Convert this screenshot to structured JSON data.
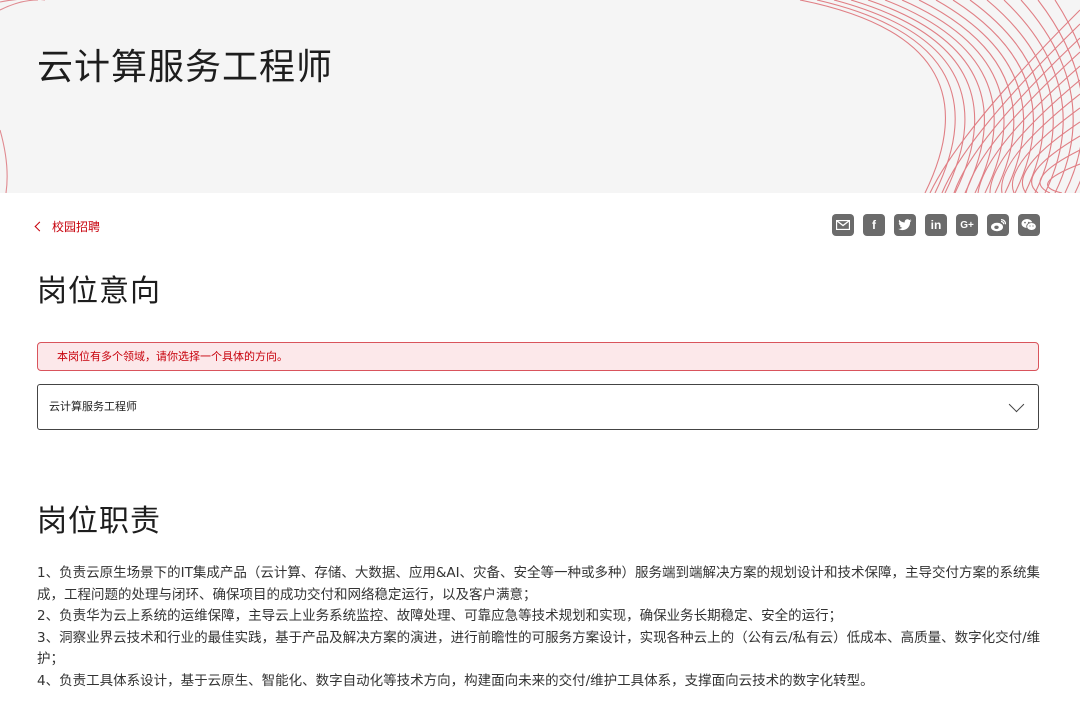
{
  "header": {
    "title": "云计算服务工程师"
  },
  "nav": {
    "back_label": "校园招聘"
  },
  "share_icons": [
    {
      "icon": "email-icon",
      "glyph": ""
    },
    {
      "icon": "facebook-icon",
      "glyph": "f"
    },
    {
      "icon": "twitter-icon",
      "glyph": ""
    },
    {
      "icon": "linkedin-icon",
      "glyph": "in"
    },
    {
      "icon": "google-plus-icon",
      "glyph": "G+"
    },
    {
      "icon": "weibo-icon",
      "glyph": ""
    },
    {
      "icon": "wechat-icon",
      "glyph": ""
    }
  ],
  "intent": {
    "heading": "岗位意向",
    "alert": "本岗位有多个领域，请你选择一个具体的方向。",
    "selected": "云计算服务工程师"
  },
  "duties": {
    "heading": "岗位职责",
    "items": [
      "1、负责云原生场景下的IT集成产品（云计算、存储、大数据、应用&AI、灾备、安全等一种或多种）服务端到端解决方案的规划设计和技术保障，主导交付方案的系统集成，工程问题的处理与闭环、确保项目的成功交付和网络稳定运行，以及客户满意；",
      "2、负责华为云上系统的运维保障，主导云上业务系统监控、故障处理、可靠应急等技术规划和实现，确保业务长期稳定、安全的运行；",
      "3、洞察业界云技术和行业的最佳实践，基于产品及解决方案的演进，进行前瞻性的可服务方案设计，实现各种云上的（公有云/私有云）低成本、高质量、数字化交付/维护；",
      "4、负责工具体系设计，基于云原生、智能化、数字自动化等技术方向，构建面向未来的交付/维护工具体系，支撑面向云技术的数字化转型。"
    ]
  },
  "colors": {
    "accent": "#c7000b",
    "hero_bg": "#f5f5f5",
    "icon_bg": "#6b6b6b"
  }
}
